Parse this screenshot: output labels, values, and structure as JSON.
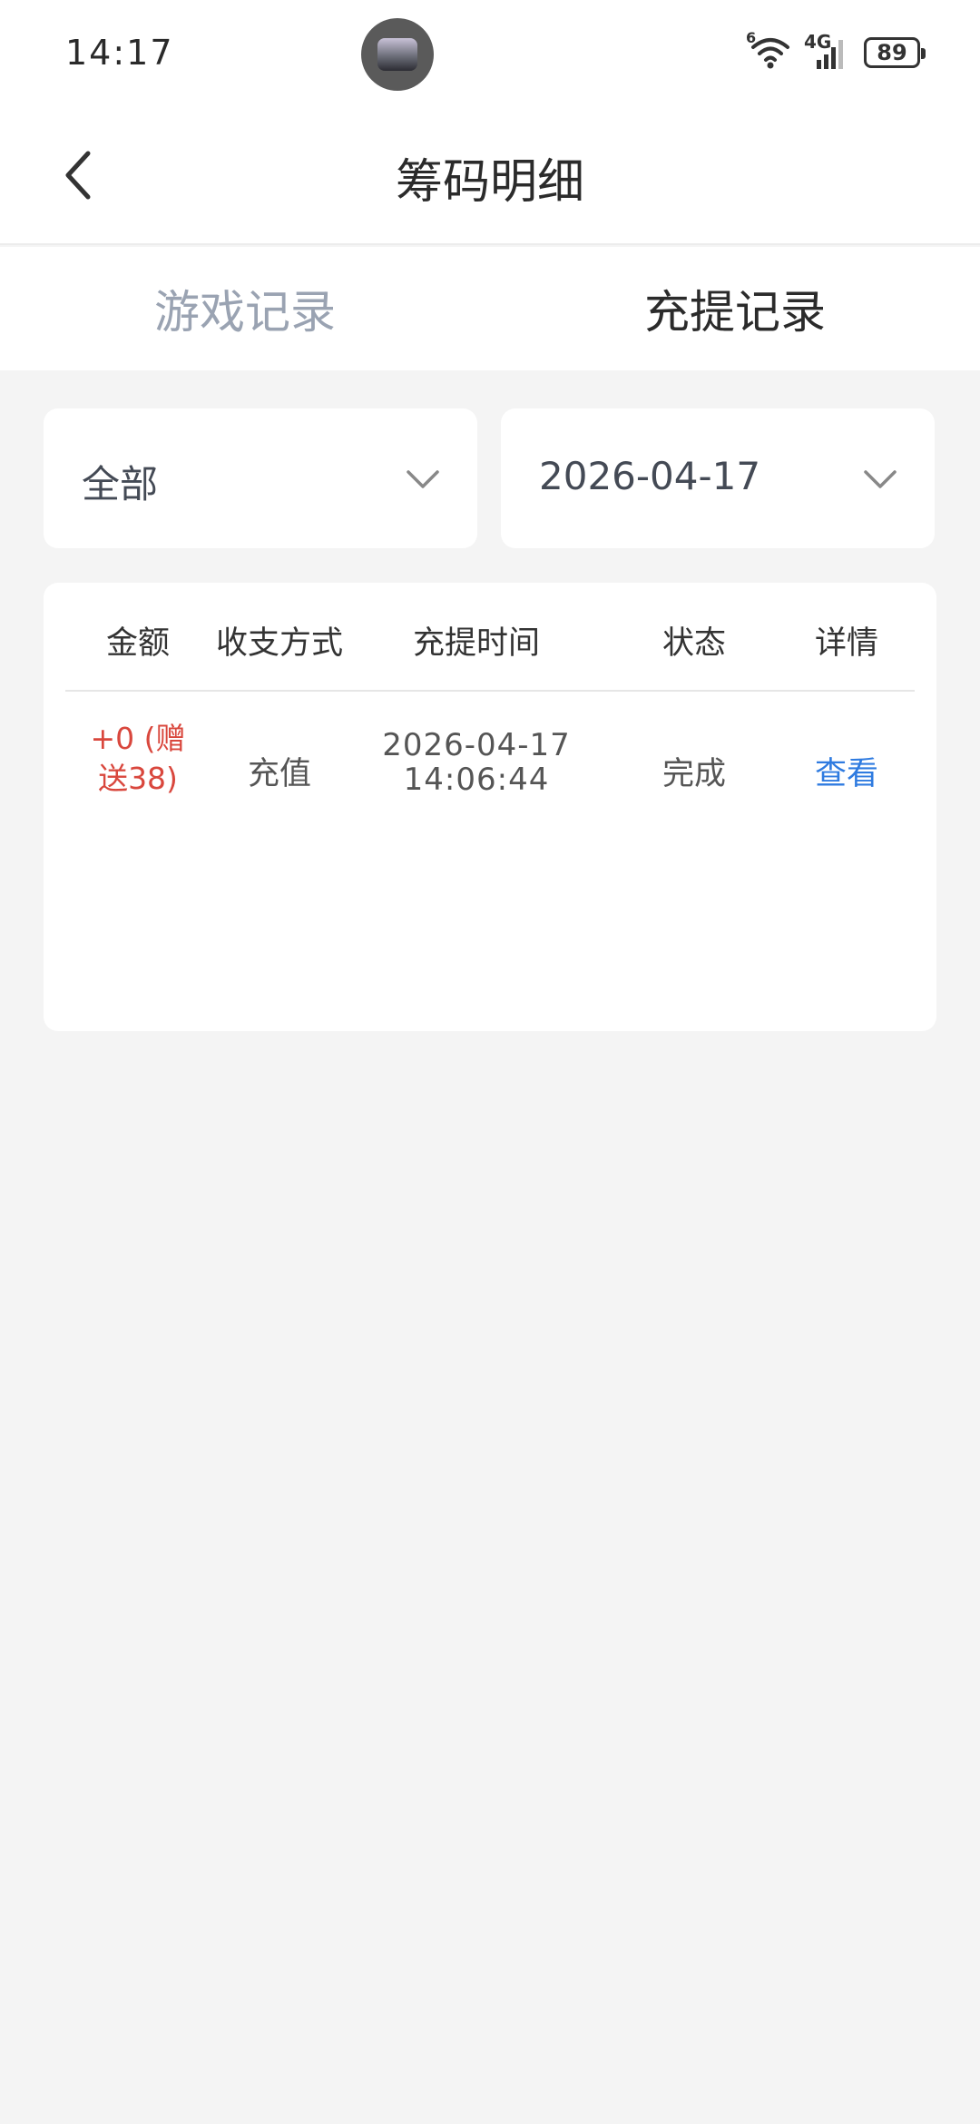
{
  "status_bar": {
    "time": "14:17",
    "battery": "89",
    "network": "4G",
    "wifi_badge": "6"
  },
  "header": {
    "title": "筹码明细"
  },
  "tabs": [
    {
      "label": "游戏记录",
      "active": false
    },
    {
      "label": "充提记录",
      "active": true
    }
  ],
  "filters": {
    "type": "全部",
    "date": "2026-04-17"
  },
  "table": {
    "headers": [
      "金额",
      "收支方式",
      "充提时间",
      "状态",
      "详情"
    ],
    "rows": [
      {
        "amount_line1": "+0 (赠",
        "amount_line2": "送38)",
        "method": "充值",
        "date": "2026-04-17",
        "time": "14:06:44",
        "status": "完成",
        "detail": "查看"
      }
    ]
  },
  "colors": {
    "amount": "#d9473d",
    "link": "#2f7be0",
    "tab_inactive": "#9aa3b2",
    "background": "#f4f4f4"
  }
}
